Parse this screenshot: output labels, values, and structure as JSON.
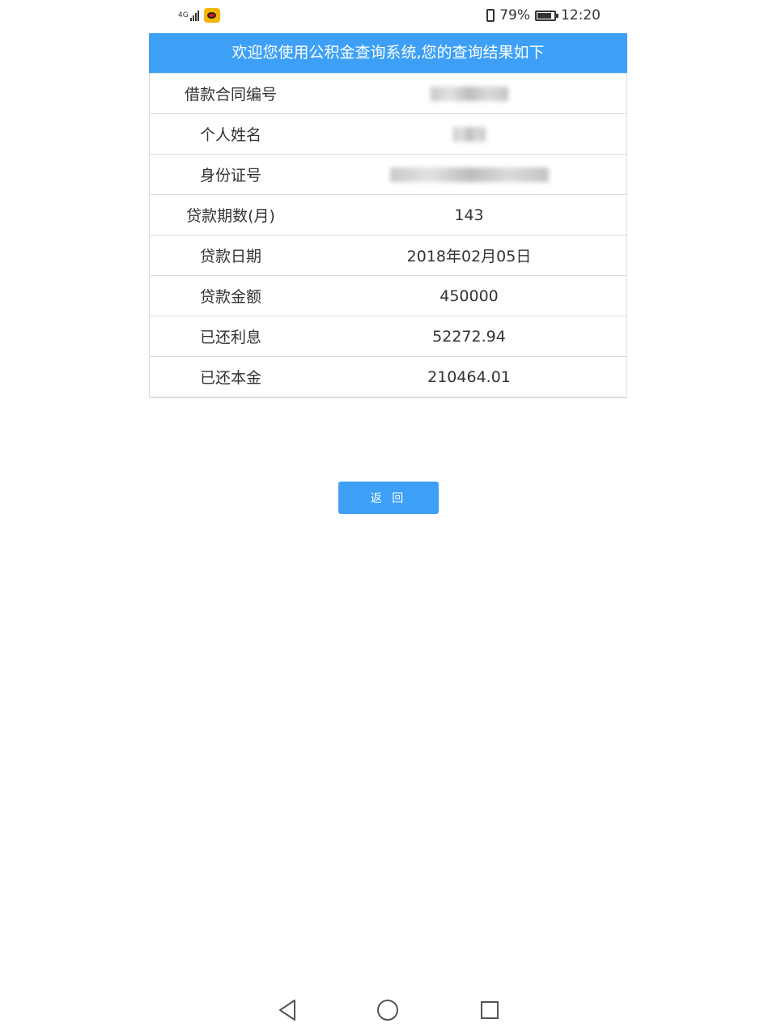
{
  "status_bar": {
    "network": "4G",
    "battery_percent": "79%",
    "time": "12:20"
  },
  "header": {
    "title": "欢迎您使用公积金查询系统,您的查询结果如下"
  },
  "rows": [
    {
      "label": "借款合同编号",
      "value": null
    },
    {
      "label": "个人姓名",
      "value": null
    },
    {
      "label": "身份证号",
      "value": null
    },
    {
      "label": "贷款期数(月)",
      "value": "143"
    },
    {
      "label": "贷款日期",
      "value": "2018年02月05日"
    },
    {
      "label": "贷款金额",
      "value": "450000"
    },
    {
      "label": "已还利息",
      "value": "52272.94"
    },
    {
      "label": "已还本金",
      "value": "210464.01"
    }
  ],
  "return_button": {
    "label": "返 回"
  },
  "colors": {
    "accent": "#3da0f6"
  }
}
